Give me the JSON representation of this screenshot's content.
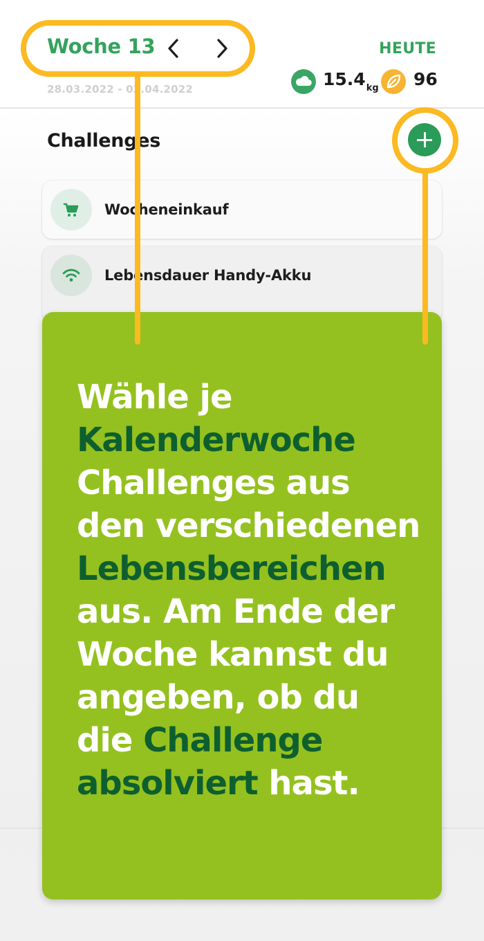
{
  "header": {
    "week_label": "Woche 13",
    "date_range": "28.03.2022 - 03.04.2022",
    "today_label": "HEUTE",
    "co2_value": "15.4",
    "co2_unit": "kg",
    "points_value": "96"
  },
  "challenges": {
    "section_title": "Challenges",
    "items": [
      {
        "label": "Wocheneinkauf",
        "icon": "shopping-cart-icon"
      },
      {
        "label": "Lebensdauer Handy-Akku",
        "icon": "wifi-icon"
      }
    ]
  },
  "tooltip": {
    "segments": [
      "Wähle je ",
      "Kalenderwoche",
      " Challenges aus den verschiedenen ",
      "Lebensbereichen",
      " aus. Am Ende der Woche kannst du angeben, ob du die ",
      "Challenge absolviert",
      " hast."
    ]
  },
  "colors": {
    "accent_green": "#33a35c",
    "highlight_yellow": "#fcb921",
    "tooltip_green": "#94c11f",
    "tooltip_highlight": "#0e5f2f",
    "points_orange": "#f7b431"
  }
}
